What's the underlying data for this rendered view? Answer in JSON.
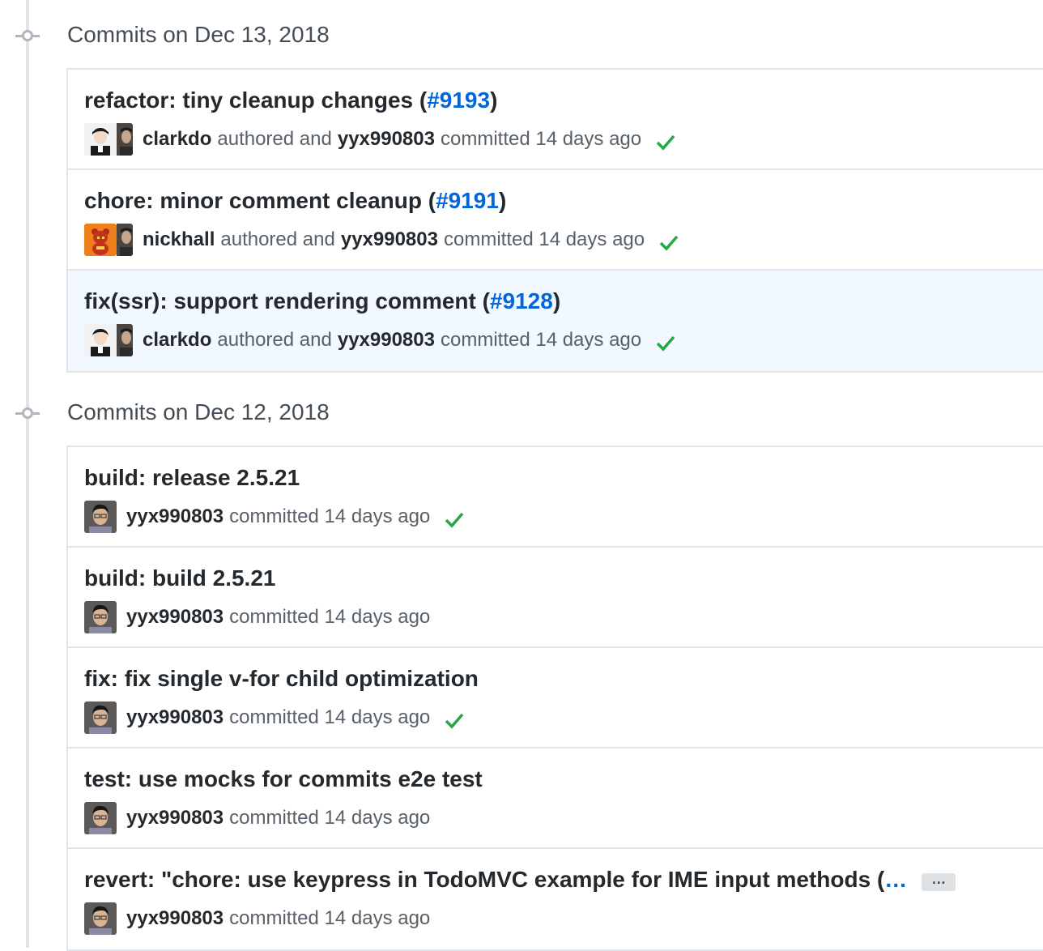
{
  "groups": [
    {
      "title": "Commits on Dec 13, 2018",
      "commits": [
        {
          "title_text": "refactor: tiny cleanup changes (",
          "pr": "#9193",
          "title_end": ")",
          "author": "clarkdo",
          "authored_label": "authored and",
          "committer": "yyx990803",
          "committed_label": "committed 14 days ago",
          "verified": true
        },
        {
          "title_text": "chore: minor comment cleanup (",
          "pr": "#9191",
          "title_end": ")",
          "author": "nickhall",
          "authored_label": "authored and",
          "committer": "yyx990803",
          "committed_label": "committed 14 days ago",
          "verified": true
        },
        {
          "title_text": "fix(ssr): support rendering comment (",
          "pr": "#9128",
          "title_end": ")",
          "author": "clarkdo",
          "authored_label": "authored and",
          "committer": "yyx990803",
          "committed_label": "committed 14 days ago",
          "verified": true
        }
      ]
    },
    {
      "title": "Commits on Dec 12, 2018",
      "commits": [
        {
          "title_text": "build: release 2.5.21",
          "committer": "yyx990803",
          "committed_label": "committed 14 days ago",
          "verified": true
        },
        {
          "title_text": "build: build 2.5.21",
          "committer": "yyx990803",
          "committed_label": "committed 14 days ago",
          "verified": false
        },
        {
          "title_text": "fix: fix single v-for child optimization",
          "committer": "yyx990803",
          "committed_label": "committed 14 days ago",
          "verified": true
        },
        {
          "title_text": "test: use mocks for commits e2e test",
          "committer": "yyx990803",
          "committed_label": "committed 14 days ago",
          "verified": false
        },
        {
          "title_text": "revert: \"chore: use keypress in TodoMVC example for IME input methods (",
          "title_link_ellipsis": "…",
          "ellipsis_button": "…",
          "committer": "yyx990803",
          "committed_label": "committed 14 days ago",
          "verified": false
        }
      ]
    }
  ],
  "colors": {
    "link": "#0366d6",
    "verified_check": "#28a745",
    "highlight_row": "#f1f8ff",
    "border": "#e1e4e8"
  },
  "icons": {
    "timeline": "git-commit-icon",
    "verified": "check-icon",
    "expand": "ellipsis-icon"
  }
}
